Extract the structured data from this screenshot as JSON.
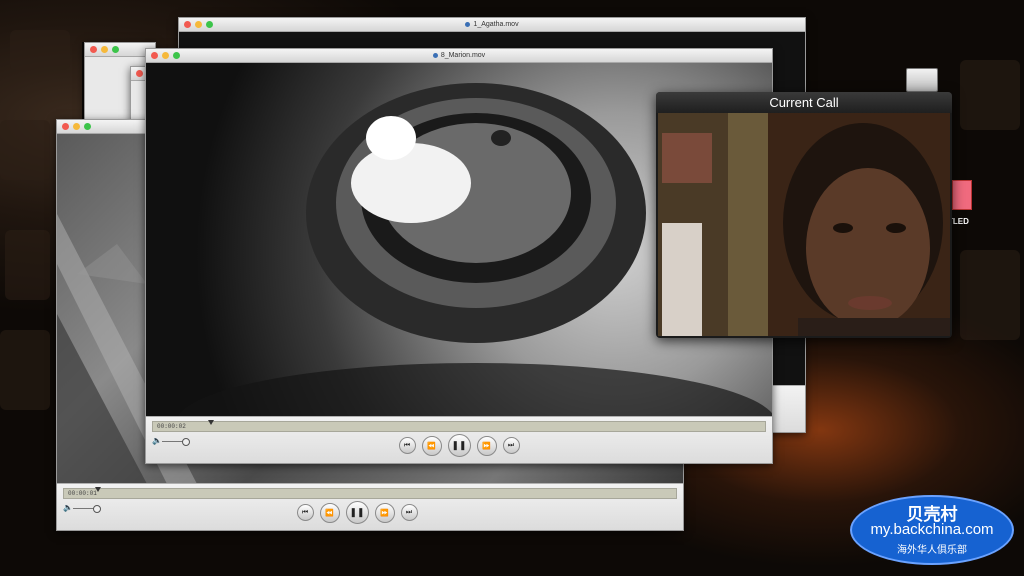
{
  "windows": {
    "agatha": {
      "title": "1_Agatha.mov"
    },
    "marion": {
      "title": "8_Marion.mov",
      "timecode": "00:00:02",
      "progress": 0.09
    },
    "left_player": {
      "timecode": "00:00:01",
      "progress": 0.05
    }
  },
  "call": {
    "title": "Current Call"
  },
  "desktop": {
    "label_fragment": "TLED"
  },
  "icons": {
    "volume": "speaker-icon",
    "prev": "skip-back-icon",
    "rewind": "rewind-icon",
    "pause": "pause-icon",
    "forward": "fast-forward-icon",
    "next": "skip-forward-icon"
  },
  "watermark": {
    "line1": "贝壳村",
    "line2": "my.backchina.com",
    "line3": "海外华人俱乐部"
  },
  "colors": {
    "close": "#f25a50",
    "minimize": "#f6b93b",
    "zoom": "#3cc44a",
    "watermark_bg": "#1662d1"
  }
}
